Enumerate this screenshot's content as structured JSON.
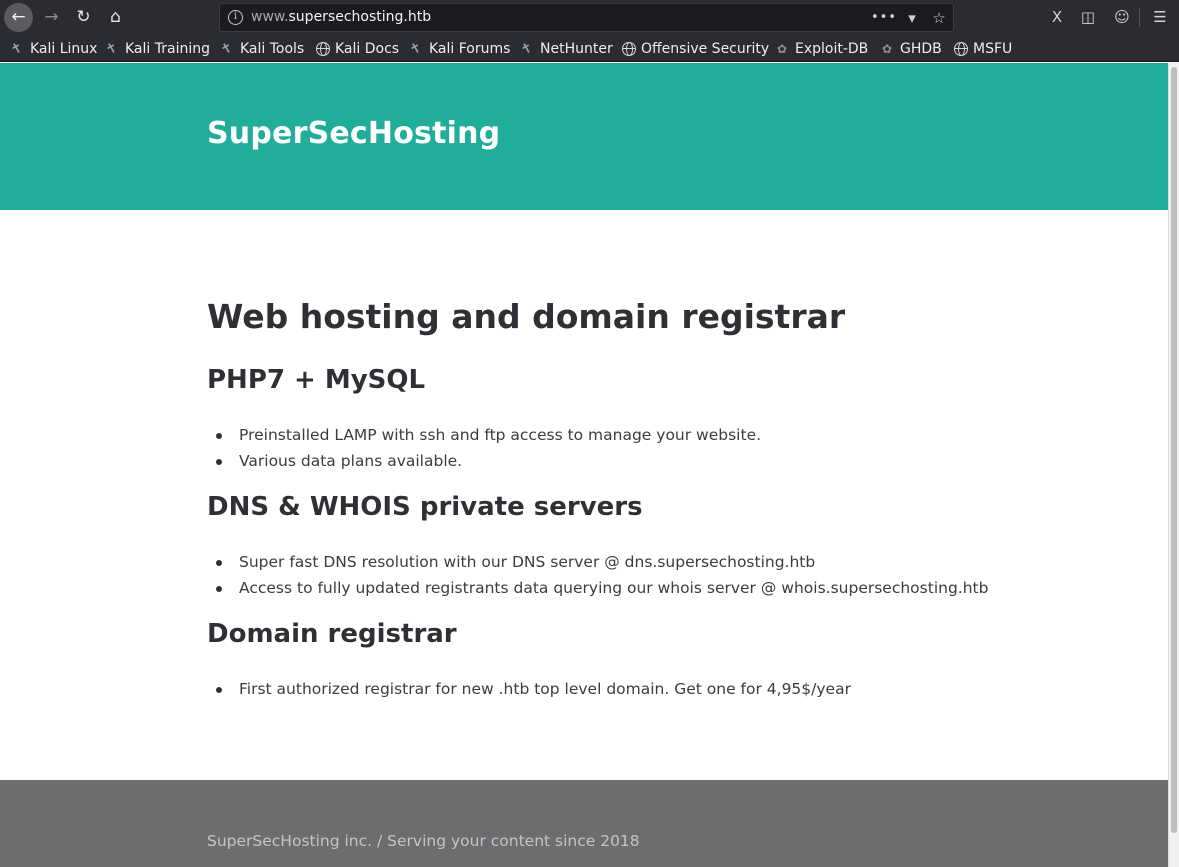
{
  "browser": {
    "url_host_prefix": "www.",
    "url_host_main": "supersechosting.htb",
    "url_actions_dots": "•••",
    "bookmarks": [
      {
        "label": "Kali Linux",
        "icon": "kali-dragon-icon"
      },
      {
        "label": "Kali Training",
        "icon": "kali-dragon-icon"
      },
      {
        "label": "Kali Tools",
        "icon": "kali-dragon-icon"
      },
      {
        "label": "Kali Docs",
        "icon": "globe-icon"
      },
      {
        "label": "Kali Forums",
        "icon": "kali-dragon-icon"
      },
      {
        "label": "NetHunter",
        "icon": "kali-dragon-icon"
      },
      {
        "label": "Offensive Security",
        "icon": "globe-icon"
      },
      {
        "label": "Exploit-DB",
        "icon": "bug-icon"
      },
      {
        "label": "GHDB",
        "icon": "bug-icon"
      },
      {
        "label": "MSFU",
        "icon": "globe-icon"
      }
    ]
  },
  "page": {
    "brand": "SuperSecHosting",
    "headline": "Web hosting and domain registrar",
    "sections": [
      {
        "title": "PHP7 + MySQL",
        "items": [
          "Preinstalled LAMP with ssh and ftp access to manage your website.",
          "Various data plans available."
        ]
      },
      {
        "title": "DNS & WHOIS private servers",
        "items": [
          "Super fast DNS resolution with our DNS server @ dns.supersechosting.htb",
          "Access to fully updated registrants data querying our whois server @ whois.supersechosting.htb"
        ]
      },
      {
        "title": "Domain registrar",
        "items": [
          "First authorized registrar for new .htb top level domain. Get one for 4,95$/year"
        ]
      }
    ],
    "footer": "SuperSecHosting inc. / Serving your content since 2018"
  },
  "colors": {
    "hero_bg": "#20ad99",
    "footer_bg": "#6c6d6f",
    "chrome_bg": "#2b2c31"
  }
}
